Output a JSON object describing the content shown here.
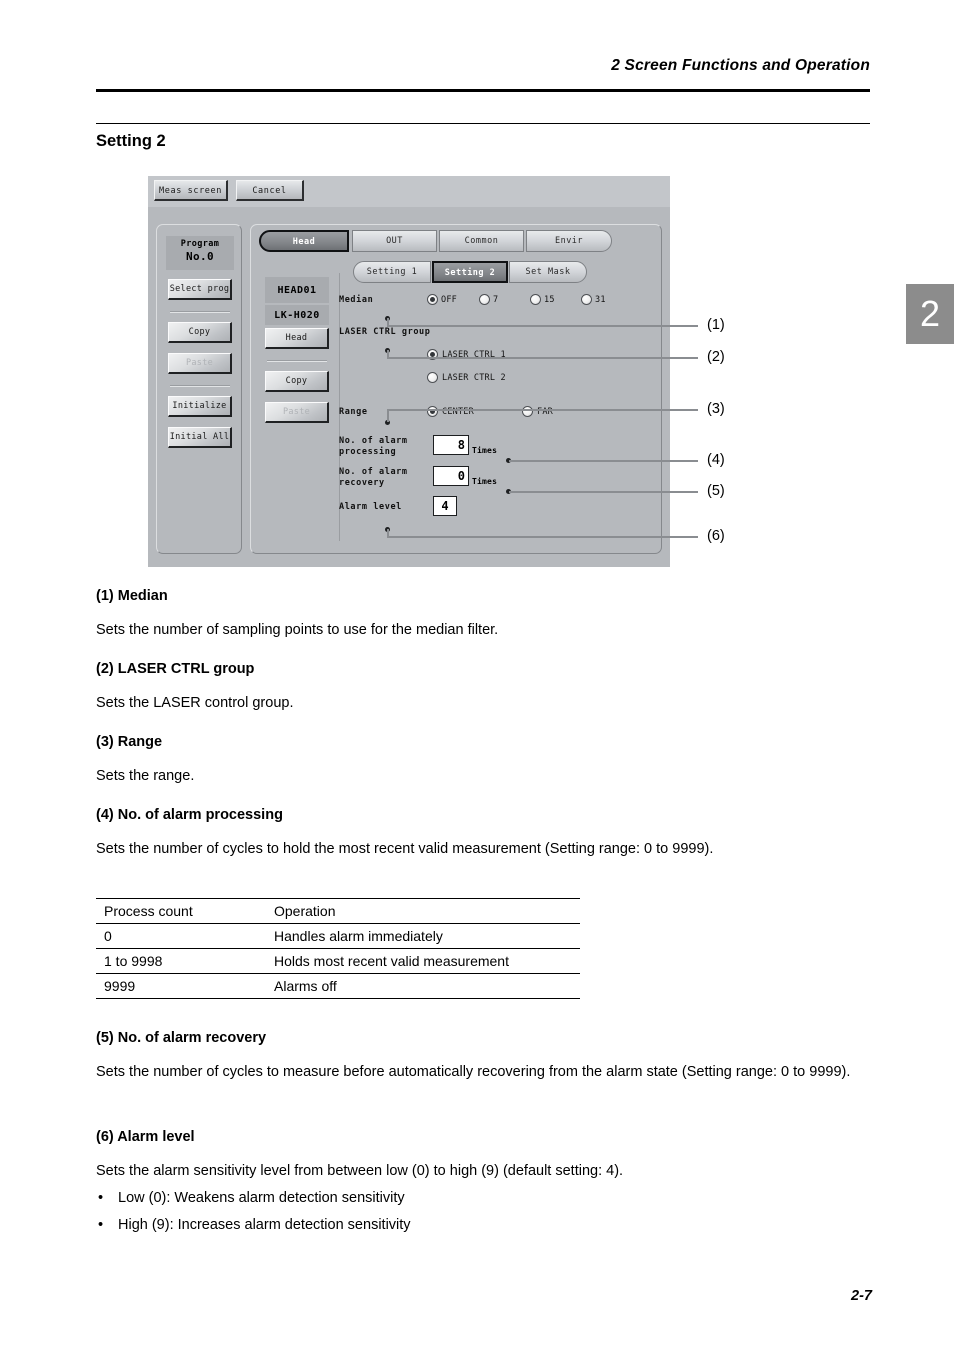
{
  "header": {
    "running_head": "2  Screen Functions and Operation",
    "section_title": "Setting 2",
    "chapter_tab": "2",
    "page_number": "2-7"
  },
  "device_screen": {
    "toolbar": {
      "meas_screen": "Meas screen",
      "cancel": "Cancel"
    },
    "program_panel": {
      "title": "Program",
      "value": "No.0",
      "buttons": [
        {
          "label": "Select prog",
          "disabled": false
        },
        {
          "label": "Copy",
          "disabled": false
        },
        {
          "label": "Paste",
          "disabled": true
        },
        {
          "label": "Initialize",
          "disabled": false
        },
        {
          "label": "Initial All",
          "disabled": false
        }
      ]
    },
    "head_panel": {
      "head_name": "HEAD01",
      "model": "LK-H020",
      "buttons": [
        {
          "label": "Head",
          "disabled": false
        },
        {
          "label": "Copy",
          "disabled": false
        },
        {
          "label": "Paste",
          "disabled": true
        }
      ]
    },
    "main_tabs": [
      {
        "label": "Head",
        "selected": true
      },
      {
        "label": "OUT",
        "selected": false
      },
      {
        "label": "Common",
        "selected": false
      },
      {
        "label": "Envir",
        "selected": false
      }
    ],
    "sub_tabs": [
      {
        "label": "Setting 1",
        "selected": false
      },
      {
        "label": "Setting 2",
        "selected": true
      },
      {
        "label": "Set Mask",
        "selected": false
      }
    ],
    "settings": {
      "median": {
        "label": "Median",
        "options": [
          {
            "label": "OFF",
            "selected": true
          },
          {
            "label": "7",
            "selected": false
          },
          {
            "label": "15",
            "selected": false
          },
          {
            "label": "31",
            "selected": false
          }
        ]
      },
      "laser_ctrl_group": {
        "label": "LASER CTRL group",
        "options": [
          {
            "label": "LASER CTRL 1",
            "selected": true
          },
          {
            "label": "LASER CTRL 2",
            "selected": false
          }
        ]
      },
      "range": {
        "label": "Range",
        "options": [
          {
            "label": "CENTER",
            "selected": true
          },
          {
            "label": "FAR",
            "selected": false
          }
        ]
      },
      "alarm_processing": {
        "label_line1": "No. of  alarm",
        "label_line2": "processing",
        "value": "8",
        "unit": "Times"
      },
      "alarm_recovery": {
        "label_line1": "No. of alarm",
        "label_line2": "recovery",
        "value": "0",
        "unit": "Times"
      },
      "alarm_level": {
        "label": "Alarm level",
        "value": "4"
      }
    },
    "callouts": [
      "(1)",
      "(2)",
      "(3)",
      "(4)",
      "(5)",
      "(6)"
    ]
  },
  "content": {
    "items": [
      {
        "heading": "(1) Median",
        "body": "Sets the number of sampling points to use for the median filter."
      },
      {
        "heading": "(2) LASER CTRL group",
        "body": "Sets the LASER control group."
      },
      {
        "heading": "(3) Range",
        "body": "Sets the range."
      },
      {
        "heading": "(4) No. of alarm processing",
        "body": "Sets the number of cycles to hold the most recent valid measurement (Setting range: 0 to 9999)."
      },
      {
        "heading": "(5) No. of alarm recovery",
        "body": "Sets the number of cycles to measure before automatically recovering from the alarm state (Setting range: 0 to 9999)."
      },
      {
        "heading": "(6) Alarm level",
        "body": "Sets the alarm sensitivity level from between low (0) to high (9) (default setting: 4)."
      }
    ],
    "bullets": [
      "Low (0): Weakens alarm detection sensitivity",
      "High (9): Increases alarm detection sensitivity"
    ],
    "table": {
      "headers": [
        "Process count",
        "Operation"
      ],
      "rows": [
        [
          "0",
          "Handles alarm immediately"
        ],
        [
          "1 to 9998",
          "Holds most recent valid measurement"
        ],
        [
          "9999",
          "Alarms off"
        ]
      ]
    }
  }
}
